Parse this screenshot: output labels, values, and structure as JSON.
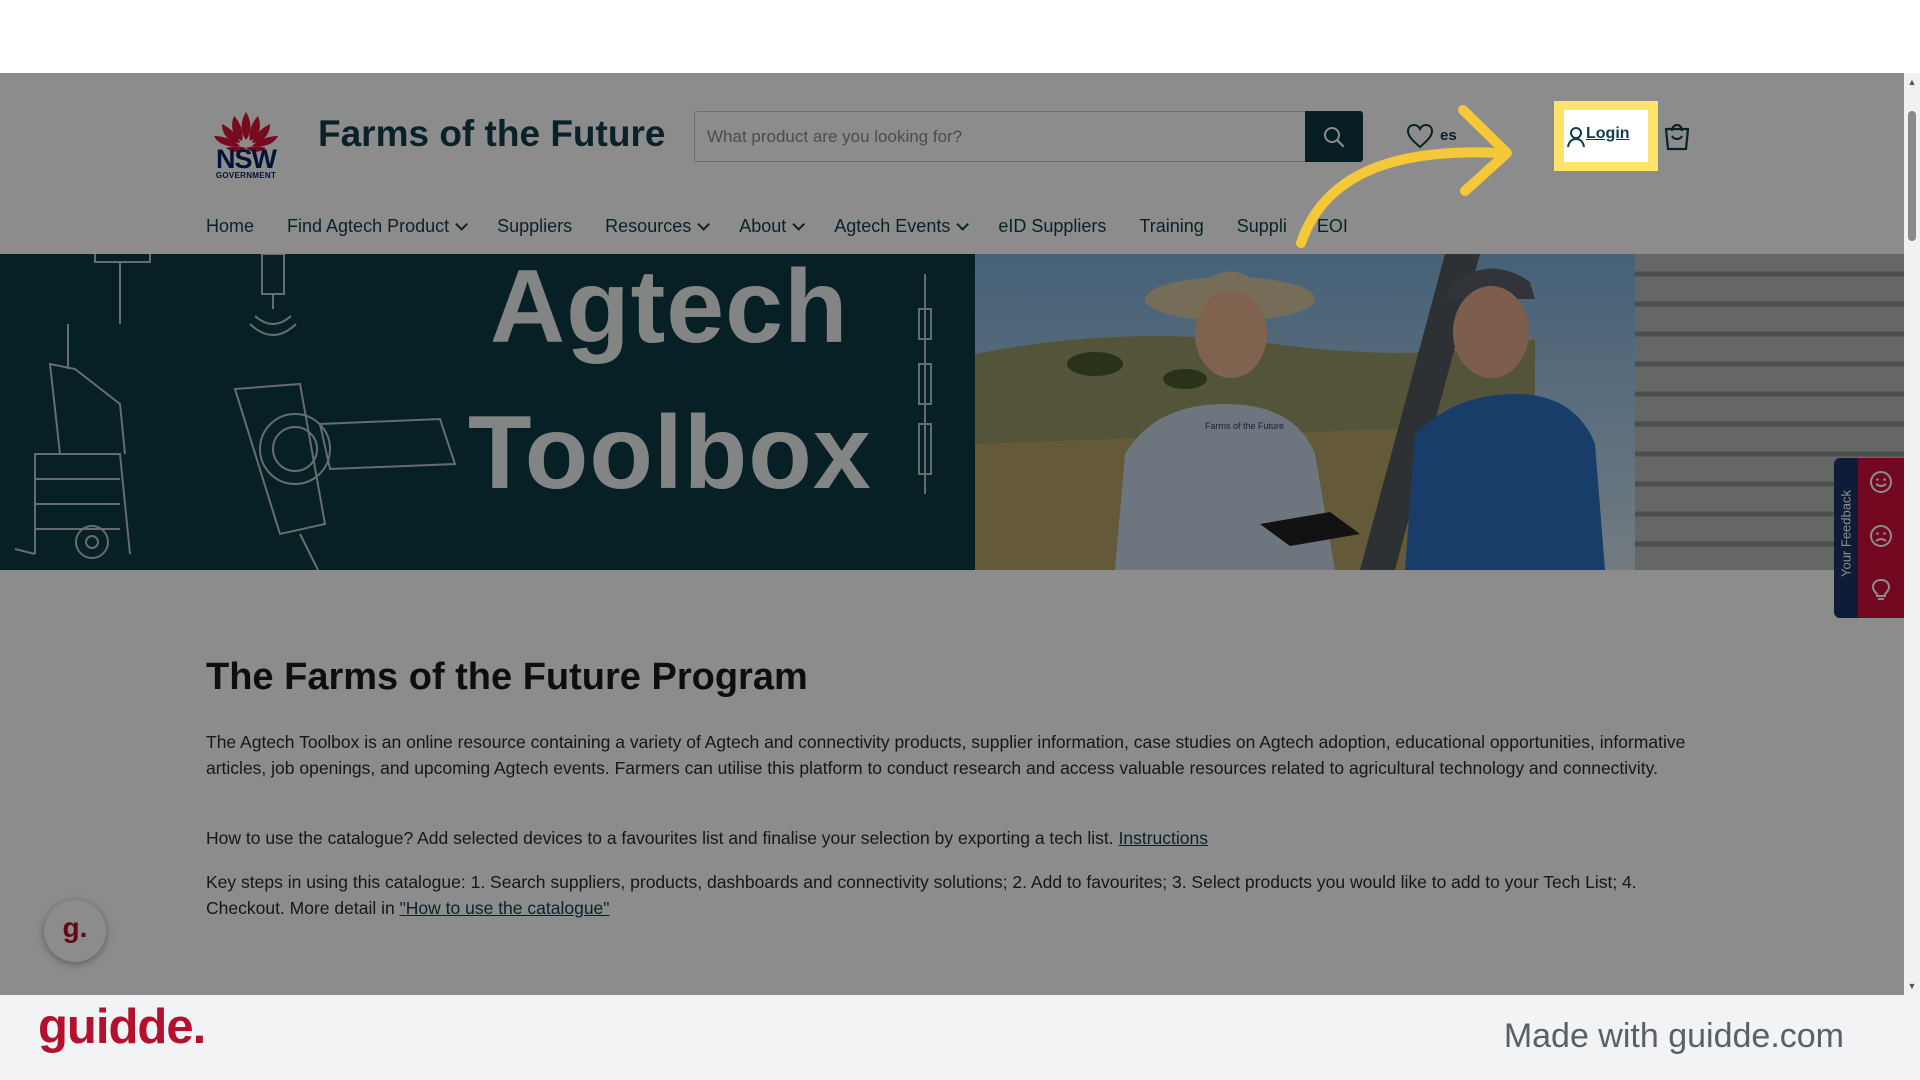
{
  "header": {
    "logo_text": "NSW",
    "logo_subtext": "GOVERNMENT",
    "site_title": "Farms of the Future",
    "search_placeholder": "What product are you looking for?",
    "favourites_partial": "es",
    "login_label": "Login"
  },
  "nav": {
    "items": [
      {
        "label": "Home"
      },
      {
        "label": "Find Agtech Product"
      },
      {
        "label": "Suppliers"
      },
      {
        "label": "Resources"
      },
      {
        "label": "About"
      },
      {
        "label": "Agtech Events"
      },
      {
        "label": "eID Suppliers"
      },
      {
        "label": "Training"
      },
      {
        "label": "Suppli",
        "label_tail": "EOI"
      }
    ]
  },
  "hero": {
    "line1": "Agtech",
    "line2": "Toolbox",
    "shirt_text": "Farms of the Future"
  },
  "content": {
    "title": "The Farms of the Future Program",
    "para1": "The Agtech Toolbox is an online resource containing a variety of Agtech and connectivity products, supplier information, case studies on Agtech adoption, educational opportunities, informative articles, job openings, and upcoming Agtech events. Farmers can utilise this platform to conduct research and access valuable resources related to agricultural technology and connectivity.",
    "para2_text": "How to use the catalogue? Add selected devices to a favourites list and finalise your selection by exporting a tech list. ",
    "para2_link": "Instructions",
    "para3_text": "Key steps in using this catalogue: 1. Search suppliers, products, dashboards and connectivity solutions; 2. Add to favourites; 3. Select products you would like to add to your Tech List; 4. Checkout. More detail in ",
    "para3_link": "\"How to use the catalogue\""
  },
  "feedback": {
    "label": "Your Feedback"
  },
  "guidde_bubble": "g.",
  "footer": {
    "logo": "guidde.",
    "made_with": "Made with guidde.com"
  },
  "colors": {
    "brand_teal": "#0d3b45",
    "highlight": "#ffe36b",
    "arrow": "#f5c83a",
    "guidde_red": "#b3112d",
    "feedback_red": "#d0103a",
    "feedback_navy": "#1d3367"
  }
}
